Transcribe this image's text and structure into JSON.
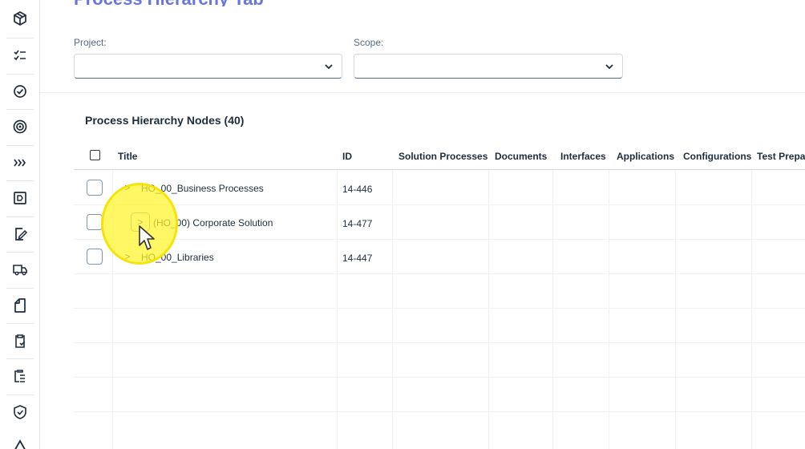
{
  "rail": {
    "items": [
      {
        "icon": "cube-icon"
      },
      {
        "icon": "checklist-icon"
      },
      {
        "icon": "badge-check-icon"
      },
      {
        "icon": "target-icon"
      },
      {
        "icon": "triple-chevron-icon"
      },
      {
        "icon": "board-icon"
      },
      {
        "icon": "edit-document-icon"
      },
      {
        "icon": "truck-icon"
      },
      {
        "icon": "document-icon"
      },
      {
        "icon": "clipboard-check-icon"
      },
      {
        "icon": "task-list-icon"
      },
      {
        "icon": "shield-check-icon"
      },
      {
        "icon": "warning-icon"
      }
    ]
  },
  "page": {
    "title": "Process Hierarchy Tab"
  },
  "filters": {
    "project_label": "Project:",
    "project_value": "",
    "scope_label": "Scope:",
    "scope_value": ""
  },
  "table": {
    "title": "Process Hierarchy Nodes (40)",
    "columns": {
      "title": "Title",
      "id": "ID",
      "solution_processes": "Solution Processes",
      "documents": "Documents",
      "interfaces": "Interfaces",
      "applications": "Applications",
      "configurations": "Configurations",
      "test_prepa": "Test Prepa"
    },
    "rows": [
      {
        "expander": ">",
        "title": "HO_00_Business Processes",
        "id": "14-446"
      },
      {
        "expander": ">",
        "title": "(HO_00) Corporate Solution",
        "id": "14-477"
      },
      {
        "expander": ">",
        "title": "HO_00_Libraries",
        "id": "14-447"
      }
    ]
  }
}
